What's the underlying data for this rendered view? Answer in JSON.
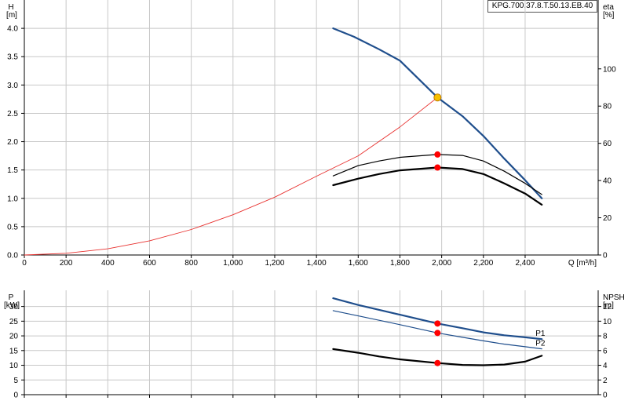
{
  "model_label": "KPG.700.37.8.T.50.13.EB.40",
  "chart_data": [
    {
      "type": "line",
      "panel": "top",
      "x_axis": {
        "label": "Q [m³/h]",
        "range": [
          0,
          2750
        ],
        "ticks": [
          0,
          200,
          400,
          600,
          800,
          1000,
          1200,
          1400,
          1600,
          1800,
          2000,
          2200,
          2400
        ],
        "tick_labels": [
          "0",
          "200",
          "400",
          "600",
          "800",
          "1,000",
          "1,200",
          "1,400",
          "1,600",
          "1,800",
          "2,000",
          "2,200",
          "2,400"
        ]
      },
      "y_left": {
        "label_top": "H",
        "label_unit": "[m]",
        "range": [
          0,
          4.5
        ],
        "ticks": [
          0,
          0.5,
          1.0,
          1.5,
          2.0,
          2.5,
          3.0,
          3.5,
          4.0
        ],
        "tick_labels": [
          "0.0",
          "0.5",
          "1.0",
          "1.5",
          "2.0",
          "2.5",
          "3.0",
          "3.5",
          "4.0"
        ]
      },
      "y_right": {
        "label_top": "eta",
        "label_unit": "[%]",
        "range": [
          0,
          137
        ],
        "ticks": [
          0,
          20,
          40,
          60,
          80,
          100
        ],
        "tick_labels": [
          "0",
          "20",
          "40",
          "60",
          "80",
          "100"
        ]
      },
      "grid": true,
      "series": [
        {
          "id": "head",
          "axis": "left",
          "color": "#1f4e8c",
          "width": 2.2,
          "points": [
            [
              1480,
              4.0
            ],
            [
              1580,
              3.85
            ],
            [
              1700,
              3.63
            ],
            [
              1800,
              3.43
            ],
            [
              1980,
              2.78
            ],
            [
              2100,
              2.45
            ],
            [
              2200,
              2.1
            ],
            [
              2300,
              1.7
            ],
            [
              2400,
              1.32
            ],
            [
              2480,
              1.0
            ]
          ]
        },
        {
          "id": "system",
          "axis": "left",
          "color": "#e8312f",
          "width": 0.9,
          "points": [
            [
              0,
              0.0
            ],
            [
              200,
              0.03
            ],
            [
              400,
              0.11
            ],
            [
              600,
              0.25
            ],
            [
              800,
              0.45
            ],
            [
              1000,
              0.71
            ],
            [
              1200,
              1.02
            ],
            [
              1400,
              1.39
            ],
            [
              1600,
              1.75
            ],
            [
              1800,
              2.26
            ],
            [
              1980,
              2.78
            ]
          ]
        },
        {
          "id": "eta_1",
          "axis": "right",
          "color": "#000000",
          "width": 1.2,
          "points": [
            [
              1480,
              42.5
            ],
            [
              1600,
              48
            ],
            [
              1700,
              50.5
            ],
            [
              1800,
              52.5
            ],
            [
              1980,
              54
            ],
            [
              2100,
              53.5
            ],
            [
              2200,
              50.5
            ],
            [
              2300,
              45
            ],
            [
              2400,
              38.5
            ],
            [
              2480,
              32.5
            ]
          ]
        },
        {
          "id": "eta_2",
          "axis": "right",
          "color": "#000000",
          "width": 2.2,
          "points": [
            [
              1480,
              37.5
            ],
            [
              1600,
              41
            ],
            [
              1700,
              43.5
            ],
            [
              1800,
              45.5
            ],
            [
              1980,
              47
            ],
            [
              2100,
              46.2
            ],
            [
              2200,
              43.5
            ],
            [
              2300,
              38.5
            ],
            [
              2400,
              33
            ],
            [
              2480,
              27
            ]
          ]
        }
      ],
      "markers": [
        {
          "axis": "left",
          "x": 1980,
          "y": 2.78,
          "color": "#f5c000",
          "stroke": "#c07a00",
          "r": 4.5
        },
        {
          "axis": "right",
          "x": 1980,
          "y": 54,
          "color": "#ff0000",
          "stroke": "#ff0000",
          "r": 3.5
        },
        {
          "axis": "right",
          "x": 1980,
          "y": 47,
          "color": "#ff0000",
          "stroke": "#ff0000",
          "r": 3.5
        }
      ]
    },
    {
      "type": "line",
      "panel": "bottom",
      "x_axis": {
        "range": [
          0,
          2750
        ]
      },
      "y_left": {
        "label_top": "P",
        "label_unit": "[kW]",
        "range": [
          0,
          35.5
        ],
        "ticks": [
          0,
          5,
          10,
          15,
          20,
          25,
          30
        ],
        "tick_labels": [
          "0",
          "5",
          "10",
          "15",
          "20",
          "25",
          "30"
        ]
      },
      "y_right": {
        "label_top": "NPSH",
        "label_unit": "[m]",
        "range": [
          0,
          14.2
        ],
        "ticks": [
          0,
          2,
          4,
          6,
          8,
          10,
          12
        ],
        "tick_labels": [
          "0",
          "2",
          "4",
          "6",
          "8",
          "10",
          "12"
        ]
      },
      "grid": true,
      "series": [
        {
          "id": "p1",
          "name": "P1",
          "axis": "left",
          "color": "#1f4e8c",
          "width": 2.2,
          "points": [
            [
              1480,
              32.8
            ],
            [
              1600,
              30.5
            ],
            [
              1800,
              27.2
            ],
            [
              1980,
              24.2
            ],
            [
              2100,
              22.6
            ],
            [
              2200,
              21.2
            ],
            [
              2300,
              20.2
            ],
            [
              2400,
              19.5
            ],
            [
              2480,
              18.9
            ]
          ]
        },
        {
          "id": "p2",
          "name": "P2",
          "axis": "left",
          "color": "#1f4e8c",
          "width": 1.2,
          "points": [
            [
              1480,
              28.6
            ],
            [
              1600,
              26.8
            ],
            [
              1800,
              23.8
            ],
            [
              1980,
              21.0
            ],
            [
              2100,
              19.5
            ],
            [
              2200,
              18.3
            ],
            [
              2300,
              17.2
            ],
            [
              2400,
              16.3
            ],
            [
              2480,
              15.6
            ]
          ]
        },
        {
          "id": "npsh",
          "axis": "right",
          "color": "#000000",
          "width": 2.2,
          "points": [
            [
              1480,
              6.2
            ],
            [
              1600,
              5.7
            ],
            [
              1700,
              5.2
            ],
            [
              1800,
              4.8
            ],
            [
              1980,
              4.3
            ],
            [
              2100,
              4.05
            ],
            [
              2200,
              4.0
            ],
            [
              2300,
              4.1
            ],
            [
              2400,
              4.5
            ],
            [
              2480,
              5.3
            ]
          ]
        }
      ],
      "markers": [
        {
          "axis": "left",
          "x": 1980,
          "y": 24.2,
          "color": "#ff0000",
          "stroke": "#ff0000",
          "r": 3.5
        },
        {
          "axis": "left",
          "x": 1980,
          "y": 21.0,
          "color": "#ff0000",
          "stroke": "#ff0000",
          "r": 3.5
        },
        {
          "axis": "right",
          "x": 1980,
          "y": 4.3,
          "color": "#ff0000",
          "stroke": "#ff0000",
          "r": 3.5
        }
      ]
    }
  ]
}
